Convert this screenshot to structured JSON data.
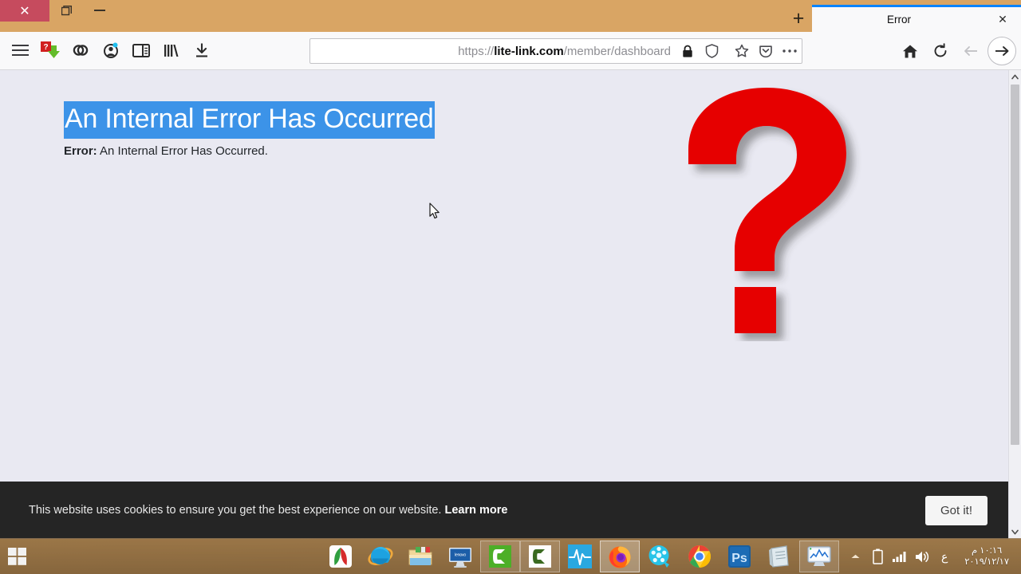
{
  "window": {
    "controls": {
      "close": "✕",
      "restore": "❐",
      "minimize": "—"
    },
    "new_tab": "+",
    "tab": {
      "title": "Error",
      "close": "✕"
    }
  },
  "toolbar": {
    "left_icons": [
      {
        "name": "hamburger-menu-icon",
        "label": "Open menu"
      },
      {
        "name": "idm-extension-icon",
        "label": "Internet Download Manager"
      },
      {
        "name": "link-extension-icon",
        "label": "Link extension"
      },
      {
        "name": "account-icon",
        "label": "Account"
      },
      {
        "name": "sidebar-toggle-icon",
        "label": "Toggle sidebar"
      },
      {
        "name": "library-icon",
        "label": "Library"
      },
      {
        "name": "downloads-icon",
        "label": "Downloads"
      }
    ],
    "right_icons": [
      {
        "name": "home-icon",
        "label": "Home"
      },
      {
        "name": "reload-icon",
        "label": "Reload"
      },
      {
        "name": "forward-icon",
        "label": "Forward"
      },
      {
        "name": "back-icon",
        "label": "Back"
      }
    ]
  },
  "urlbar": {
    "scheme": "https://",
    "domain": "lite-link.com",
    "path": "/member/dashboard",
    "full_url": "https://lite-link.com/member/dashboard",
    "lock": "🔒",
    "icons": [
      {
        "name": "bookmark-star-icon",
        "label": "Bookmark this page"
      },
      {
        "name": "pocket-icon",
        "label": "Save to Pocket"
      },
      {
        "name": "page-actions-icon",
        "label": "Page actions"
      }
    ]
  },
  "page": {
    "heading": "An Internal Error Has Occurred",
    "error_label": "Error:",
    "error_message": "An Internal Error Has Occurred.",
    "illustration": "red-question-mark",
    "background_color": "#e9e9f2",
    "selection_color": "#3c93e8"
  },
  "cookie_banner": {
    "message": "This website uses cookies to ensure you get the best experience on our website.",
    "learn_more": "Learn more",
    "accept_button": "Got it!",
    "background_color": "#252525"
  },
  "scrollbar": {
    "up_arrow": "▲",
    "down_arrow": "▼"
  },
  "taskbar": {
    "clock_time": "١٠:١٦ م",
    "clock_date": "٢٠١٩/١٢/١٧",
    "tray_items": [
      {
        "name": "tray-ime-icon",
        "label": "ع"
      },
      {
        "name": "tray-volume-icon",
        "label": "Volume"
      },
      {
        "name": "tray-network-icon",
        "label": "Network"
      },
      {
        "name": "tray-battery-icon",
        "label": "Battery"
      },
      {
        "name": "tray-show-hidden-icon",
        "label": "Show hidden icons"
      }
    ],
    "apps": [
      {
        "name": "taskbar-app-system-monitor",
        "label": "System Monitor",
        "active": true
      },
      {
        "name": "taskbar-app-notepad",
        "label": "Notepad",
        "active": false
      },
      {
        "name": "taskbar-app-photoshop",
        "label": "Adobe Photoshop",
        "active": false
      },
      {
        "name": "taskbar-app-chrome",
        "label": "Google Chrome",
        "active": false
      },
      {
        "name": "taskbar-app-media-player",
        "label": "Media Player",
        "active": false
      },
      {
        "name": "taskbar-app-firefox",
        "label": "Mozilla Firefox",
        "active": true
      },
      {
        "name": "taskbar-app-activity-monitor",
        "label": "Activity Monitor",
        "active": false
      },
      {
        "name": "taskbar-app-camtasia-editor",
        "label": "Camtasia Editor",
        "active": true
      },
      {
        "name": "taskbar-app-camtasia-recorder",
        "label": "Camtasia Recorder",
        "active": true
      },
      {
        "name": "taskbar-app-lenovo",
        "label": "Lenovo",
        "active": false
      },
      {
        "name": "taskbar-app-file-explorer",
        "label": "File Explorer",
        "active": false
      },
      {
        "name": "taskbar-app-internet-explorer",
        "label": "Internet Explorer",
        "active": false
      },
      {
        "name": "taskbar-app-idm",
        "label": "Internet Download Manager",
        "active": false
      }
    ],
    "start_button": "Start"
  }
}
